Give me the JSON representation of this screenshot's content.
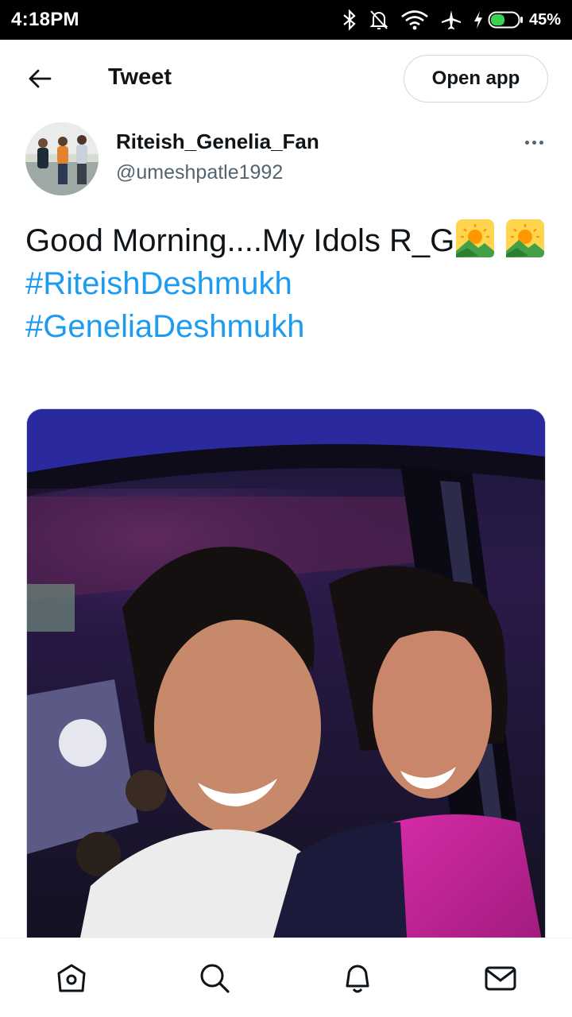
{
  "status_bar": {
    "time": "4:18PM",
    "battery_percent": "45%",
    "icons": [
      "bluetooth-icon",
      "bell-off-icon",
      "wifi-icon",
      "airplane-icon",
      "charging-icon",
      "battery-icon"
    ]
  },
  "header": {
    "title": "Tweet",
    "open_app_label": "Open app"
  },
  "tweet": {
    "author": {
      "display_name": "Riteish_Genelia_Fan",
      "handle": "@umeshpatle1992"
    },
    "text": "Good Morning....My Idols R_G",
    "hashtags": [
      "#RiteishDeshmukh",
      "#GeneliaDeshmukh"
    ],
    "emoji": "sunrise-over-mountains"
  },
  "bottom_nav": {
    "items": [
      "home-icon",
      "search-icon",
      "notifications-icon",
      "messages-icon"
    ]
  },
  "colors": {
    "link": "#1d9bf0",
    "secondary_text": "#536471",
    "border": "#cfd9de"
  }
}
